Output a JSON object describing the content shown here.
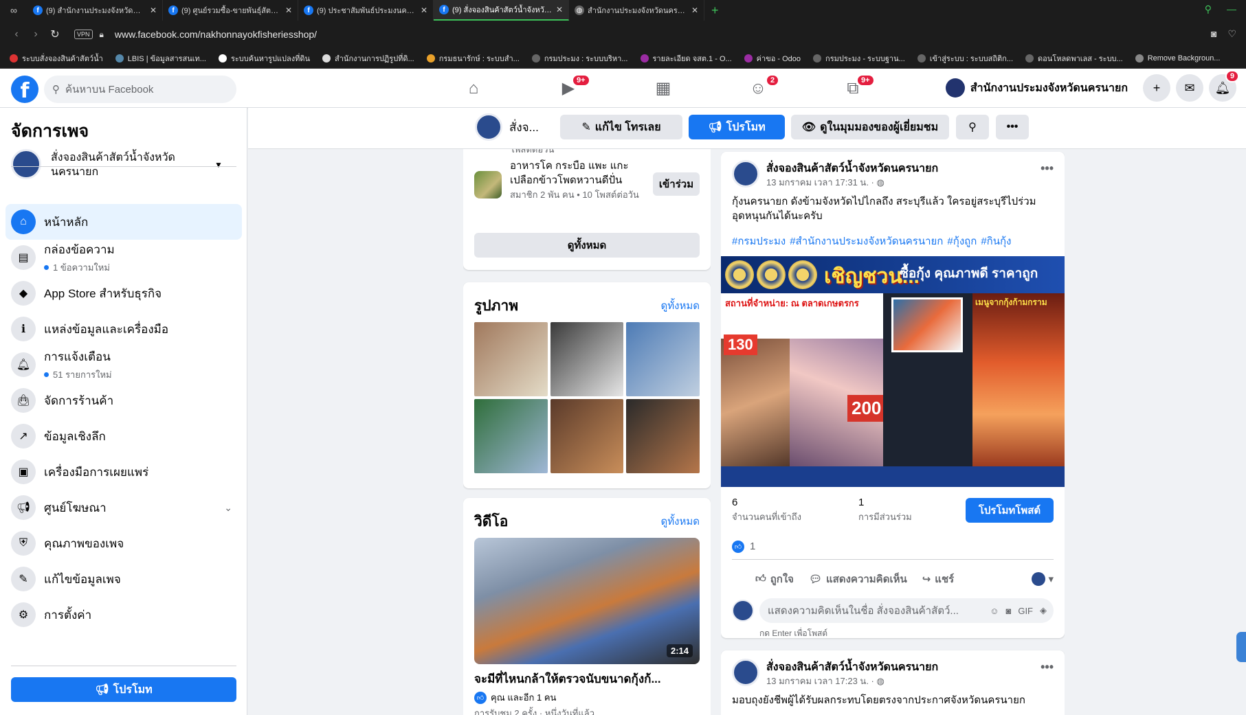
{
  "browser": {
    "tabs": [
      {
        "title": "(9) สำนักงานประมงจังหวัดนครนายก",
        "active": false
      },
      {
        "title": "(9) ศูนย์รวมซื้อ-ขายพันธุ์สัตว์น้ำ",
        "active": false
      },
      {
        "title": "(9) ประชาสัมพันธ์ประมงนครนายก",
        "active": false
      },
      {
        "title": "(9) สั่งจองสินค้าสัตว์น้ำจังหวัดนครนายก",
        "active": true
      },
      {
        "title": "สำนักงานประมงจังหวัดนครนายก",
        "active": false
      }
    ],
    "url": "www.facebook.com/nakhonnayokfisheriesshop/",
    "vpn_label": "VPN",
    "bookmarks": [
      {
        "label": "ระบบสั่งจองสินค้าสัตว์น้ำ",
        "color": "#d33"
      },
      {
        "label": "LBIS | ข้อมูลสารสนเท...",
        "color": "#58a"
      },
      {
        "label": "ระบบค้นหารูปแปลงที่ดิน",
        "color": "#fff"
      },
      {
        "label": "สำนักงานการปฏิรูปที่ดิ...",
        "color": "#ddd"
      },
      {
        "label": "กรมธนารักษ์ : ระบบสำ...",
        "color": "#e9a12a"
      },
      {
        "label": "กรมประมง : ระบบบริหา...",
        "color": "#666"
      },
      {
        "label": "รายละเอียด จสต.1 - O...",
        "color": "#9b2ca3"
      },
      {
        "label": "ค่าขอ - Odoo",
        "color": "#9b2ca3"
      },
      {
        "label": "กรมประมง - ระบบฐาน...",
        "color": "#666"
      },
      {
        "label": "เข้าสู่ระบบ : ระบบสถิติก...",
        "color": "#666"
      },
      {
        "label": "ดอนโหลดพาเลส - ระบบ...",
        "color": "#666"
      },
      {
        "label": "Remove Backgroun...",
        "color": "#888"
      }
    ]
  },
  "fb": {
    "search_placeholder": "ค้นหาบน Facebook",
    "nav_badges": {
      "watch": "9+",
      "groups": "2",
      "gaming": "9+"
    },
    "profile_name": "สำนักงานประมงจังหวัดนครนายก",
    "notif_badge": "9"
  },
  "sidebar": {
    "title": "จัดการเพจ",
    "page_name": "สั่งจองสินค้าสัตว์น้ำจังหวัดนครนายก",
    "items": [
      {
        "label": "หน้าหลัก",
        "icon": "home-icon",
        "sub": ""
      },
      {
        "label": "กล่องข้อความ",
        "icon": "inbox-icon",
        "sub": "1 ข้อความใหม่"
      },
      {
        "label": "App Store สำหรับธุรกิจ",
        "icon": "cube-icon",
        "sub": ""
      },
      {
        "label": "แหล่งข้อมูลและเครื่องมือ",
        "icon": "info-icon",
        "sub": ""
      },
      {
        "label": "การแจ้งเตือน",
        "icon": "bell-icon",
        "sub": "51 รายการใหม่"
      },
      {
        "label": "จัดการร้านค้า",
        "icon": "shopping-bag-icon",
        "sub": ""
      },
      {
        "label": "ข้อมูลเชิงลึก",
        "icon": "insights-icon",
        "sub": ""
      },
      {
        "label": "เครื่องมือการเผยแพร่",
        "icon": "publishing-tools-icon",
        "sub": ""
      },
      {
        "label": "ศูนย์โฆษณา",
        "icon": "megaphone-icon",
        "sub": ""
      },
      {
        "label": "คุณภาพของเพจ",
        "icon": "shield-icon",
        "sub": ""
      },
      {
        "label": "แก้ไขข้อมูลเพจ",
        "icon": "pencil-icon",
        "sub": ""
      },
      {
        "label": "การตั้งค่า",
        "icon": "gear-icon",
        "sub": ""
      }
    ],
    "promote_label": "โปรโมท"
  },
  "action_bar": {
    "page_short": "สั่งจ...",
    "edit_label": "แก้ไข โทรเลย",
    "promote_label": "โปรโมท",
    "visitor_view_label": "ดูในมุมมองของผู้เยี่ยมชม"
  },
  "groups_card": {
    "cut_text": "โพสต์ต่อวัน",
    "group_name": "อาหารโค กระบือ แพะ แกะ เปลือกข้าวโพดหวานดีปั่น",
    "group_meta": "สมาชิก 2 พัน คน • 10 โพสต์ต่อวัน",
    "join_label": "เข้าร่วม",
    "see_all_label": "ดูทั้งหมด"
  },
  "photos_card": {
    "title": "รูปภาพ",
    "see_all": "ดูทั้งหมด",
    "photo_colors": [
      [
        "#a0785c",
        "#e4dcc8"
      ],
      [
        "#3a3a3a",
        "#e6e6e6"
      ],
      [
        "#4d7bb5",
        "#c0cfe0"
      ],
      [
        "#2f6e3a",
        "#9fb7d6"
      ],
      [
        "#5a3a2a",
        "#c98e5a"
      ],
      [
        "#2a2a2a",
        "#b5764a"
      ]
    ]
  },
  "video_card": {
    "title": "วิดีโอ",
    "see_all": "ดูทั้งหมด",
    "duration": "2:14",
    "video_title": "จะมีที่ไหนกล้าให้ตรวจนับขนาดกุ้งก้...",
    "likes": "คุณ และอีก 1 คน",
    "stats": "การรับชม 2 ครั้ง · หนึ่งวันที่แล้ว"
  },
  "post1": {
    "author": "สั่งจองสินค้าสัตว์น้ำจังหวัดนครนายก",
    "time": "13 มกราคม เวลา 17:31 น. ·",
    "text": "กุ้งนครนายก ดังข้ามจังหวัดไปไกลถึง สระบุรีแล้ว ใครอยู่สระบุรีไปร่วมอุดหนุนกันได้นะครับ",
    "tags": [
      "#กรมประมง",
      "#สำนักงานประมงจังหวัดนครนายก",
      "#กุ้งถูก",
      "#กินกุ้ง"
    ],
    "poster": {
      "headline": "เชิญชวน...",
      "headline2": "ซื้อกุ้ง คุณภาพดี ราคาถูก",
      "location": "สถานที่จำหน่าย: ณ ตลาดเกษตรกร",
      "price1": "130",
      "price2": "200",
      "menu_title": "เมนูจากกุ้งก้ามกราม"
    },
    "reach_value": "6",
    "reach_label": "จำนวนคนที่เข้าถึง",
    "engagement_value": "1",
    "engagement_label": "การมีส่วนร่วม",
    "promote_post_label": "โปรโมทโพสต์",
    "like_count": "1",
    "like_label": "ถูกใจ",
    "comment_label": "แสดงความคิดเห็น",
    "share_label": "แชร์",
    "comment_placeholder": "แสดงความคิดเห็นในชื่อ สั่งจองสินค้าสัตว์...",
    "enter_hint": "กด Enter เพื่อโพสต์"
  },
  "post2": {
    "author": "สั่งจองสินค้าสัตว์น้ำจังหวัดนครนายก",
    "time": "13 มกราคม เวลา 17:23 น. ·",
    "text": "มอบถุงยังชีพผู้ได้รับผลกระทบโดยตรงจากประกาศจังหวัดนครนายก"
  }
}
